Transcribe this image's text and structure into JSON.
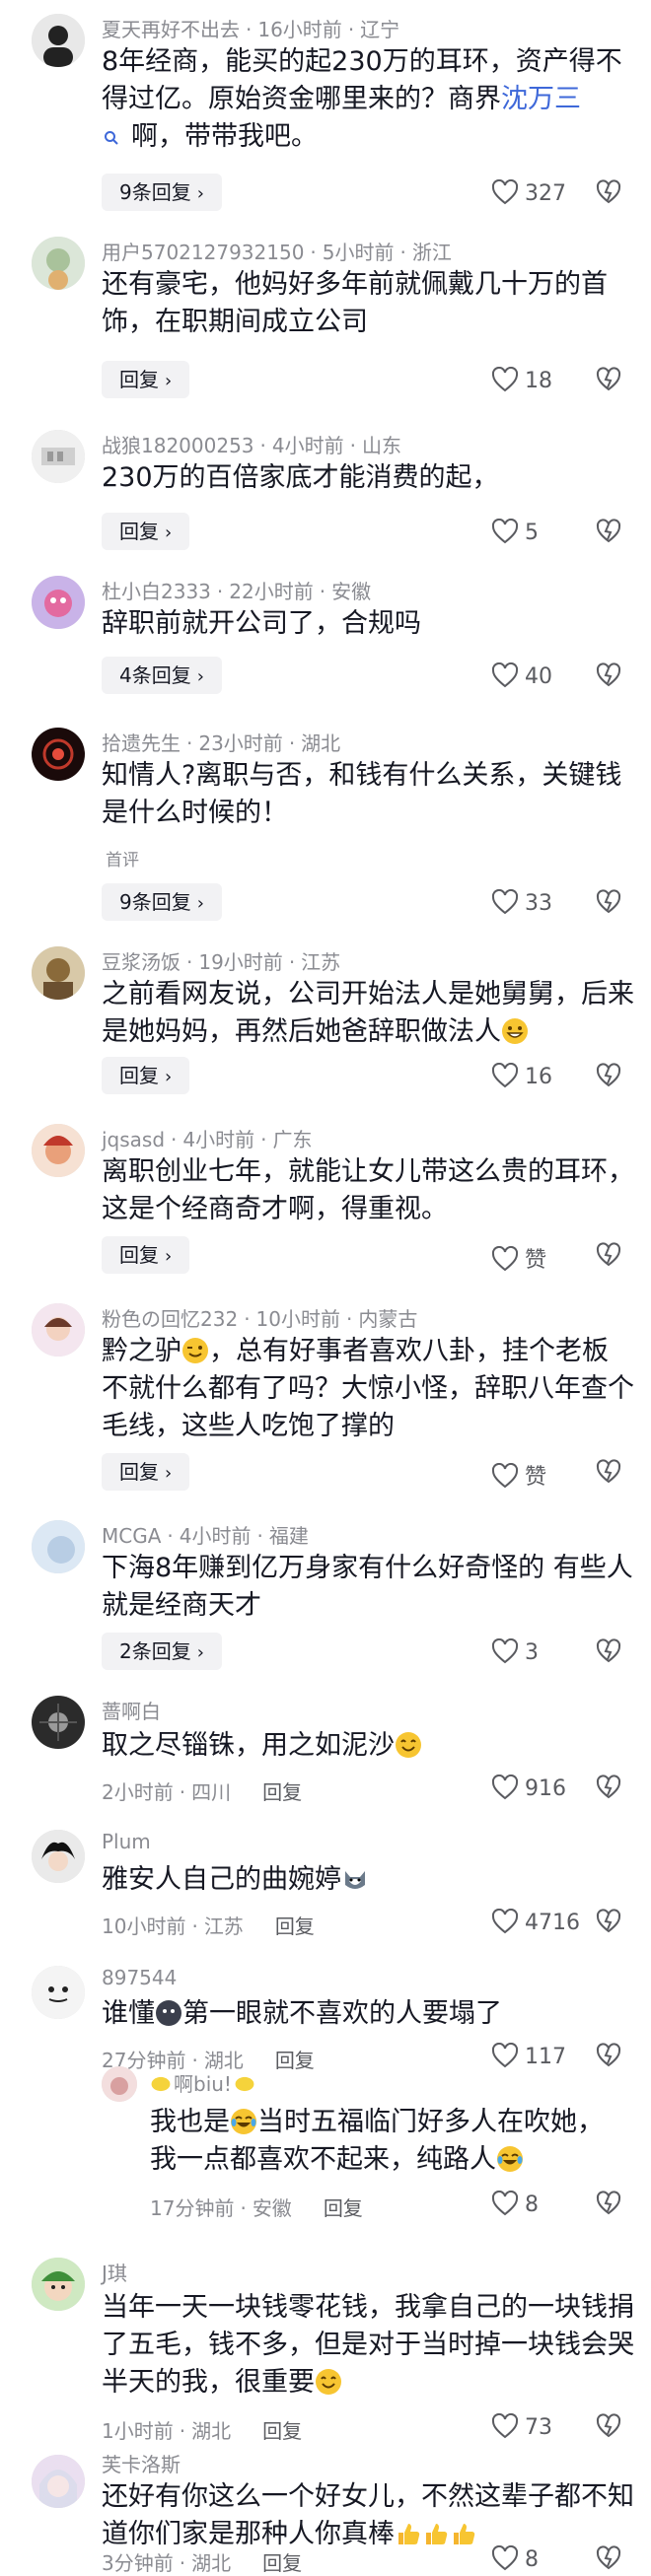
{
  "comments": [
    {
      "user": "夏天再好不出去",
      "time": "16小时前",
      "location": "辽宁",
      "text_1": "8年经商，能买的起230万的耳环，资产得不得过亿。原始资金哪里来的？商界",
      "link": "沈万三",
      "text_2": "啊，带带我吧。",
      "replies": "9条回复",
      "likes": "327"
    },
    {
      "user": "用户5702127932150",
      "time": "5小时前",
      "location": "浙江",
      "text": "还有豪宅，他妈好多年前就佩戴几十万的首饰，在职期间成立公司",
      "replies": "回复",
      "likes": "18"
    },
    {
      "user": "战狼182000253",
      "time": "4小时前",
      "location": "山东",
      "text": "230万的百倍家底才能消费的起，",
      "replies": "回复",
      "likes": "5"
    },
    {
      "user": "杜小白2333",
      "time": "22小时前",
      "location": "安徽",
      "text": "辞职前就开公司了，合规吗",
      "replies": "4条回复",
      "likes": "40"
    },
    {
      "user": "拾遗先生",
      "time": "23小时前",
      "location": "湖北",
      "text": "知情人?离职与否，和钱有什么关系，关键钱是什么时候的！",
      "tag": "首评",
      "replies": "9条回复",
      "likes": "33"
    },
    {
      "user": "豆浆汤饭",
      "time": "19小时前",
      "location": "江苏",
      "text": "之前看网友说，公司开始法人是她舅舅，后来是她妈妈，再然后她爸辞职做法人",
      "replies": "回复",
      "likes": "16"
    },
    {
      "user": "jqsasd",
      "time": "4小时前",
      "location": "广东",
      "text": "离职创业七年，就能让女儿带这么贵的耳环，这是个经商奇才啊，得重视。",
      "replies": "回复",
      "likes": "赞"
    },
    {
      "user": "粉色の回忆232",
      "time": "10小时前",
      "location": "内蒙古",
      "text_1": "黔之驴",
      "text_2": "，总有好事者喜欢八卦，挂个老板不就什么都有了吗？大惊小怪，辞职八年查个毛线，这些人吃饱了撑的",
      "replies": "回复",
      "likes": "赞"
    },
    {
      "user": "MCGA",
      "time": "4小时前",
      "location": "福建",
      "text": "下海8年赚到亿万身家有什么好奇怪的 有些人就是经商天才",
      "replies": "2条回复",
      "likes": "3"
    },
    {
      "user": "蔷啊白",
      "time": "2小时前",
      "location": "四川",
      "reply": "回复",
      "text": "取之尽锱铢，用之如泥沙",
      "likes": "916"
    },
    {
      "user": "Plum",
      "time": "10小时前",
      "location": "江苏",
      "reply": "回复",
      "text": "雅安人自己的曲婉婷",
      "likes": "4716"
    },
    {
      "user": "897544",
      "time": "27分钟前",
      "location": "湖北",
      "reply": "回复",
      "text_1": "谁懂",
      "text_2": "第一眼就不喜欢的人要塌了",
      "likes": "117"
    },
    {
      "user": "啊biu!",
      "time": "17分钟前",
      "location": "安徽",
      "reply": "回复",
      "text_1": "我也是",
      "text_2": "当时五福临门好多人在吹她，我一点都喜欢不起来，纯路人",
      "likes": "8"
    },
    {
      "user": "J琪",
      "time": "1小时前",
      "location": "湖北",
      "reply": "回复",
      "text": "当年一天一块钱零花钱，我拿自己的一块钱捐了五毛，钱不多，但是对于当时掉一块钱会哭半天的我，很重要",
      "likes": "73"
    },
    {
      "user": "芙卡洛斯",
      "time": "3分钟前",
      "location": "湖北",
      "reply": "回复",
      "text": "还好有你这么一个好女儿，不然这辈子都不知道你们家是那种人你真棒",
      "likes": "8"
    }
  ],
  "colors": {
    "link": "#3e68d9",
    "meta": "#8a8b91",
    "pill_bg": "#f2f2f4",
    "text": "#161823"
  }
}
